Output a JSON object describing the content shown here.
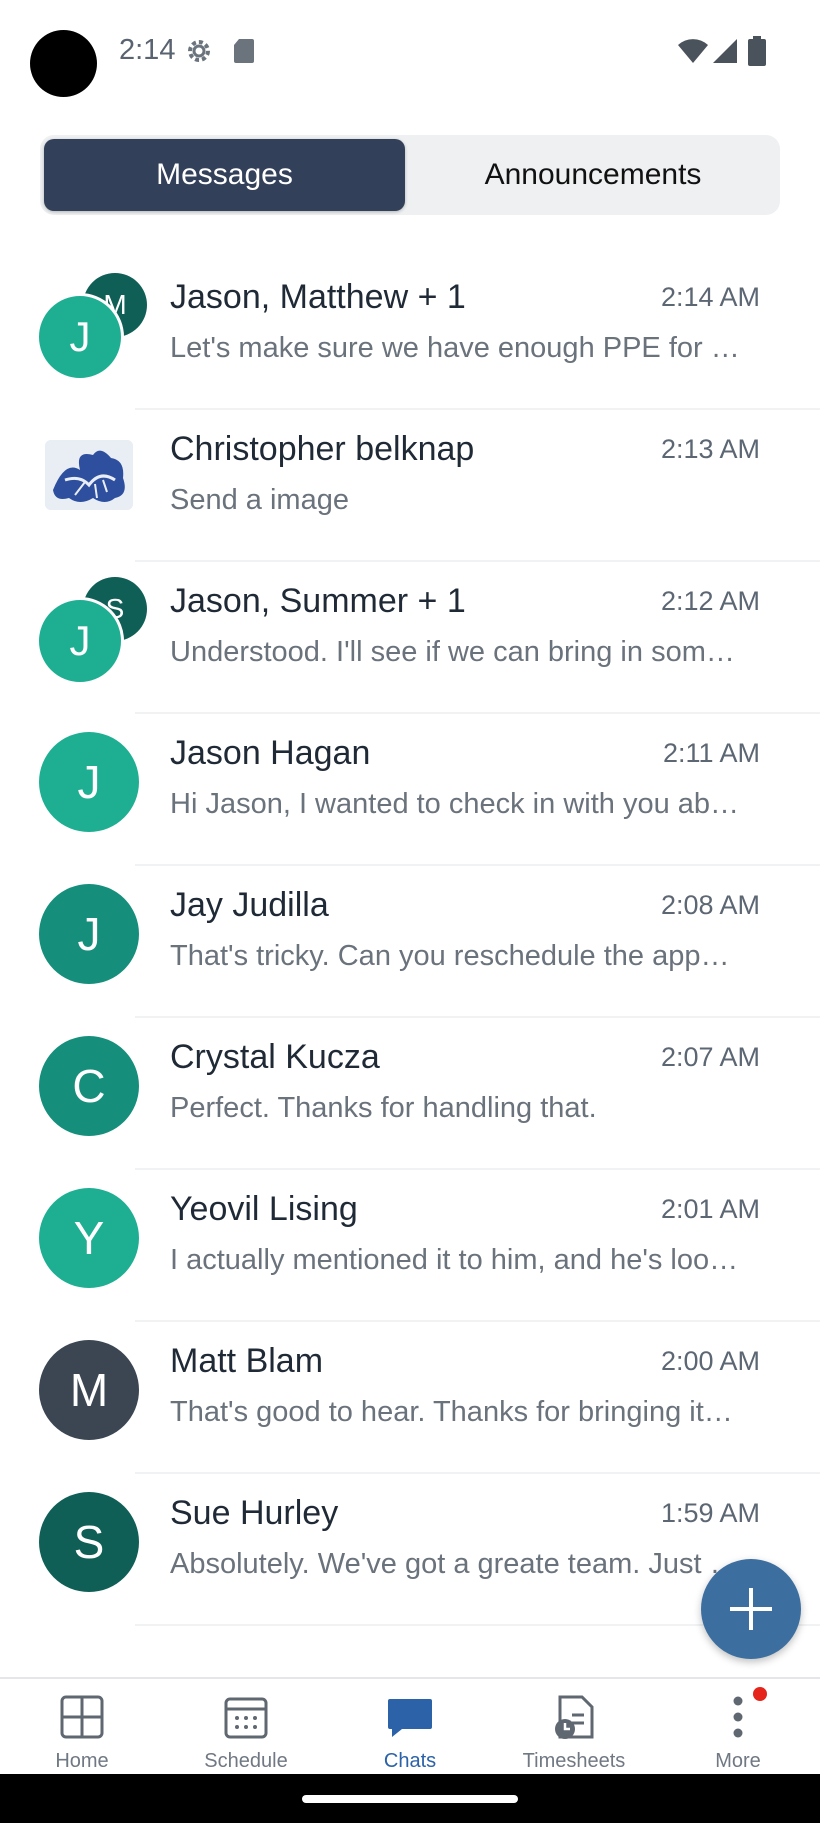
{
  "status_bar": {
    "time": "2:14"
  },
  "tabs": {
    "messages": "Messages",
    "announcements": "Announcements"
  },
  "chats": [
    {
      "name": "Jason, Matthew + 1",
      "time": "2:14 AM",
      "preview": "Let's make sure we have enough PPE for the week ahead",
      "avatar_back": "M",
      "avatar_front": "J"
    },
    {
      "name": "Christopher belknap",
      "time": "2:13 AM",
      "preview": "Send a image"
    },
    {
      "name": "Jason, Summer + 1",
      "time": "2:12 AM",
      "preview": "Understood. I'll see if we can bring in someone else",
      "avatar_back": "S",
      "avatar_front": "J"
    },
    {
      "name": "Jason Hagan",
      "time": "2:11 AM",
      "preview": "Hi Jason, I wanted to check in with you about the schedule",
      "avatar": "J"
    },
    {
      "name": "Jay Judilla",
      "time": "2:08 AM",
      "preview": "That's tricky. Can you reschedule the appointment?",
      "avatar": "J"
    },
    {
      "name": "Crystal Kucza",
      "time": "2:07 AM",
      "preview": "Perfect. Thanks for handling that.",
      "avatar": "C"
    },
    {
      "name": "Yeovil Lising",
      "time": "2:01 AM",
      "preview": "I actually mentioned it to him, and he's looking into it",
      "avatar": "Y"
    },
    {
      "name": "Matt Blam",
      "time": "2:00 AM",
      "preview": "That's good to hear. Thanks for bringing it up",
      "avatar": "M"
    },
    {
      "name": "Sue Hurley",
      "time": "1:59 AM",
      "preview": "Absolutely. We've got a greate team. Just let me know",
      "avatar": "S"
    }
  ],
  "colors": {
    "teal_light": "#1eaf93",
    "teal_mid": "#158f7b",
    "teal_dark": "#0f5f57",
    "slate": "#3b4652",
    "accent_blue": "#2c62a8",
    "fab": "#3c6f9f"
  },
  "nav": {
    "home": "Home",
    "schedule": "Schedule",
    "chats": "Chats",
    "timesheets": "Timesheets",
    "more": "More"
  },
  "icons": {
    "gear": "gear-icon",
    "sd": "sd-card-icon",
    "wifi": "wifi-icon",
    "signal": "signal-icon",
    "battery": "battery-icon",
    "fab": "plus-icon",
    "home": "home-grid-icon",
    "schedule": "calendar-icon",
    "chats": "chat-bubble-icon",
    "timesheets": "timesheet-icon",
    "more": "more-vertical-icon"
  }
}
